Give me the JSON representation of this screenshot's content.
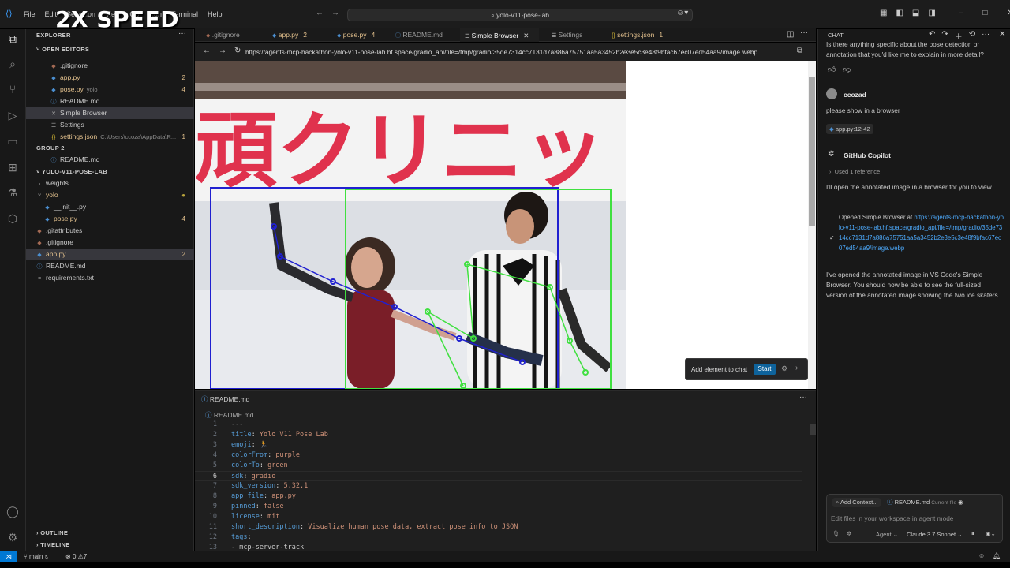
{
  "window": {
    "menu": [
      "File",
      "Edit",
      "Selection",
      "View",
      "Go",
      "Run",
      "Terminal",
      "Help"
    ],
    "command_center": "yolo-v11-pose-lab",
    "overlay_label": "2X SPEED"
  },
  "sidebar": {
    "title": "EXPLORER",
    "open_editors_label": "OPEN EDITORS",
    "open_editors": [
      {
        "label": ".gitignore",
        "icon": "gitignore-icon",
        "mod": false,
        "badge": ""
      },
      {
        "label": "app.py",
        "icon": "python-icon",
        "mod": true,
        "badge": "2"
      },
      {
        "label": "pose.py",
        "icon": "python-icon",
        "mod": true,
        "desc": "yolo",
        "badge": "4"
      },
      {
        "label": "README.md",
        "icon": "info-icon",
        "mod": false,
        "badge": ""
      },
      {
        "label": "Simple Browser",
        "icon": "browser-icon",
        "mod": false,
        "badge": "",
        "selected": true
      },
      {
        "label": "Settings",
        "icon": "settings-icon",
        "mod": false,
        "badge": ""
      },
      {
        "label": "settings.json",
        "icon": "json-icon",
        "mod": true,
        "desc": "C:\\Users\\ccoza\\AppData\\R...",
        "badge": "1"
      }
    ],
    "group2_label": "GROUP 2",
    "group2": [
      {
        "label": "README.md",
        "icon": "info-icon"
      }
    ],
    "project_label": "YOLO-V11-POSE-LAB",
    "project": [
      {
        "label": "weights",
        "type": "folder"
      },
      {
        "label": "yolo",
        "type": "folder-open",
        "mod": true
      },
      {
        "label": "__init__.py",
        "type": "file"
      },
      {
        "label": "pose.py",
        "type": "file",
        "mod": true,
        "badge": "4"
      },
      {
        "label": ".gitattributes",
        "type": "file"
      },
      {
        "label": ".gitignore",
        "type": "file"
      },
      {
        "label": "app.py",
        "type": "file",
        "mod": true,
        "badge": "2",
        "selected": true
      },
      {
        "label": "README.md",
        "type": "file"
      },
      {
        "label": "requirements.txt",
        "type": "file"
      }
    ],
    "outline_label": "OUTLINE",
    "timeline_label": "TIMELINE"
  },
  "tabs": [
    {
      "label": ".gitignore",
      "num": ""
    },
    {
      "label": "app.py",
      "num": "2"
    },
    {
      "label": "pose.py",
      "num": "4"
    },
    {
      "label": "README.md",
      "num": ""
    },
    {
      "label": "Simple Browser",
      "num": "",
      "active": true
    },
    {
      "label": "Settings",
      "num": ""
    },
    {
      "label": "settings.json",
      "num": "1"
    }
  ],
  "browser": {
    "url": "https://agents-mcp-hackathon-yolo-v11-pose-lab.hf.space/gradio_api/file=/tmp/gradio/35de7314cc7131d7a886a75751aa5a3452b2e3e5c3e48f9bfac67ec07ed54aa9/image.webp",
    "banner_text": "頑クリニッ",
    "add_element_label": "Add element to chat",
    "start_label": "Start"
  },
  "bottom_editor": {
    "tab_label": "README.md",
    "breadcrumb": "README.md",
    "lines": [
      {
        "n": "1",
        "key": "---",
        "val": ""
      },
      {
        "n": "2",
        "key": "title",
        "val": "Yolo V11 Pose Lab"
      },
      {
        "n": "3",
        "key": "emoji",
        "val": "🏃"
      },
      {
        "n": "4",
        "key": "colorFrom",
        "val": "purple"
      },
      {
        "n": "5",
        "key": "colorTo",
        "val": "green"
      },
      {
        "n": "6",
        "key": "sdk",
        "val": "gradio"
      },
      {
        "n": "7",
        "key": "sdk_version",
        "val": "5.32.1"
      },
      {
        "n": "8",
        "key": "app_file",
        "val": "app.py"
      },
      {
        "n": "9",
        "key": "pinned",
        "val": "false"
      },
      {
        "n": "10",
        "key": "license",
        "val": "mit"
      },
      {
        "n": "11",
        "key": "short_description",
        "val": "Visualize human pose data, extract pose info to JSON"
      },
      {
        "n": "12",
        "key": "tags",
        "val": ""
      },
      {
        "n": "13",
        "key": "- mcp-server-track",
        "val": ""
      }
    ]
  },
  "status": {
    "branch": "main",
    "problems": "0",
    "warnings": "7"
  },
  "chat": {
    "title": "CHAT",
    "prev_message": "Is there anything specific about the pose detection or annotation that you'd like me to explain in more detail?",
    "user_name": "ccozad",
    "user_message": "please show in a browser",
    "user_ref": "app.py:12-42",
    "bot_name": "GitHub Copilot",
    "used_refs": "Used 1 reference",
    "bot_intro": "I'll open the annotated image in a browser for you to view.",
    "tool_prefix": "Opened Simple Browser at",
    "tool_link": "https://agents-mcp-hackathon-yolo-v11-pose-lab.hf.space/gradio_api/file=/tmp/gradio/35de7314cc7131d7a886a75751aa5a3452b2e3e5c3e48f9bfac67ec07ed54aa9/image.webp",
    "bot_final": "I've opened the annotated image in VS Code's Simple Browser. You should now be able to see the full-sized version of the annotated image showing the two ice skaters",
    "input": {
      "add_context": "Add Context...",
      "current_file_name": "README.md",
      "current_file_label": "Current file",
      "placeholder": "Edit files in your workspace in agent mode",
      "mode": "Agent",
      "model": "Claude 3.7 Sonnet"
    }
  }
}
